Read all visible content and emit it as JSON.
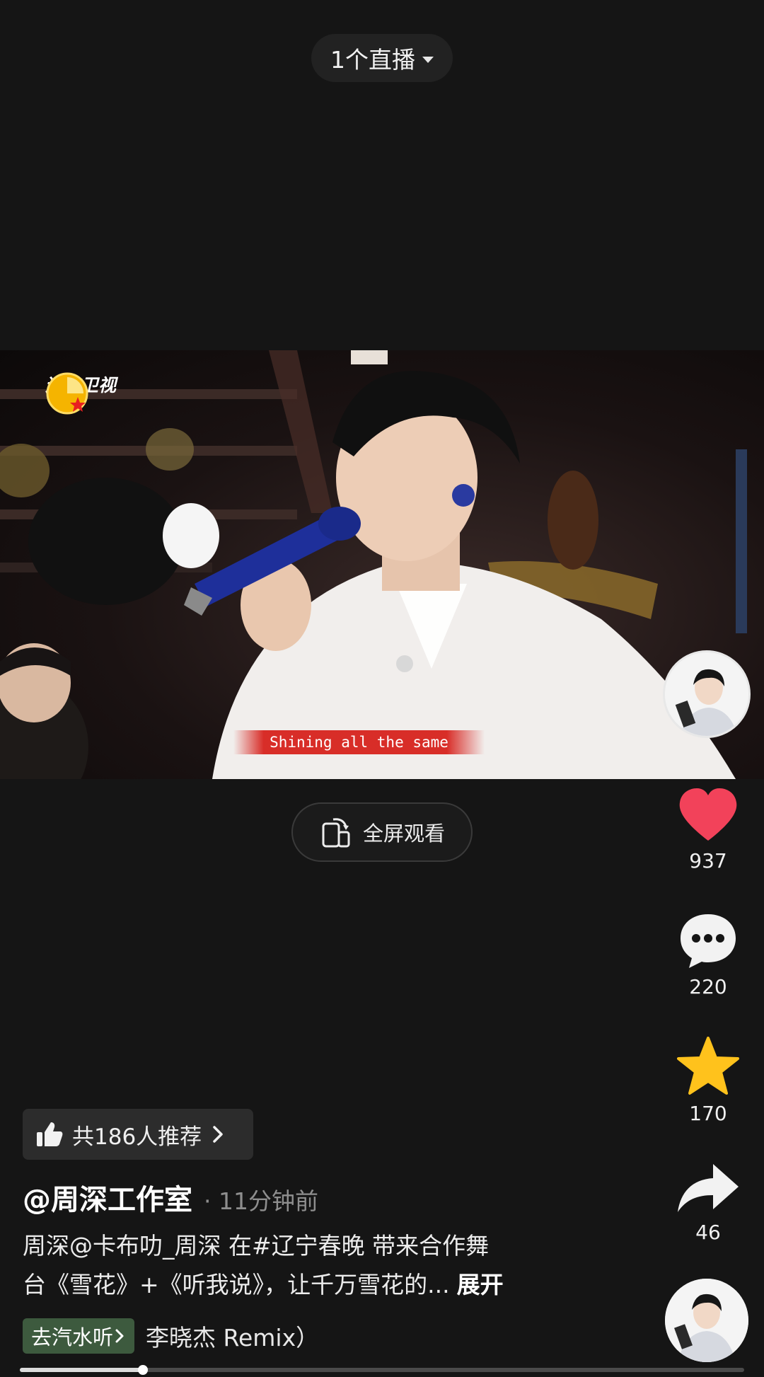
{
  "top": {
    "live_label": "1个直播"
  },
  "video": {
    "channel_name": "辽宁卫视",
    "subtitle": "Shining all the same"
  },
  "fullscreen": {
    "label": "全屏观看"
  },
  "actions": {
    "like_count": "937",
    "comment_count": "220",
    "favorite_count": "170",
    "share_count": "46"
  },
  "recommend": {
    "label": "共186人推荐"
  },
  "post": {
    "author": "@周深工作室",
    "time": "· 11分钟前",
    "caption_line1": "周深@卡布叻_周深 在#辽宁春晚 带来合作舞",
    "caption_line2": "台《雪花》+《听我说》，让千万雪花的...",
    "expand_label": "展开"
  },
  "music": {
    "soda_button": "去汽水听",
    "title": "李晓杰 Remix）"
  },
  "progress": {
    "played_fraction": 0.17
  },
  "colors": {
    "background": "#151515",
    "like": "#f2425a",
    "favorite": "#ffc21c",
    "subtitle_band": "#d7231e"
  }
}
